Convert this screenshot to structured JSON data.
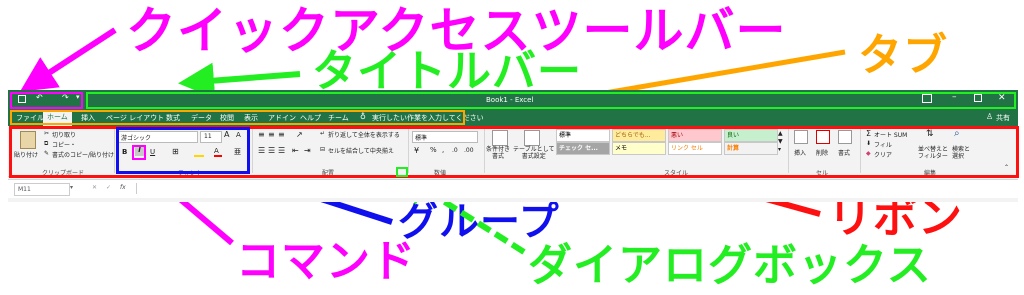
{
  "annotations": {
    "quick_access": "クイックアクセスツールバー",
    "title_bar": "タイトルバー",
    "tab": "タブ",
    "command": "コマンド",
    "group": "グループ",
    "ribbon": "リボン",
    "dialog_box": "ダイアログボックス"
  },
  "colors": {
    "magenta": "#ff00ff",
    "green": "#22ee22",
    "orange": "#ffa500",
    "blue": "#1010ee",
    "red": "#ff1010",
    "excel_green": "#217346"
  },
  "window": {
    "title": "Book1 - Excel",
    "share": "共有"
  },
  "tabs": [
    "ファイル",
    "ホーム",
    "挿入",
    "ページ レイアウト",
    "数式",
    "データ",
    "校閲",
    "表示",
    "アドイン",
    "ヘルプ",
    "チーム"
  ],
  "tell_me": "実行したい作業を入力してください",
  "clipboard": {
    "paste": "貼り付け",
    "cut": "切り取り",
    "copy": "コピー・",
    "format_painter": "書式のコピー/貼り付け",
    "label": "クリップボード"
  },
  "font": {
    "name": "游ゴシック",
    "size": "11",
    "grow": "A",
    "shrink": "A",
    "bold": "B",
    "italic": "I",
    "underline": "U",
    "label": "フォント"
  },
  "alignment": {
    "wrap": "折り返して全体を表示する",
    "merge": "セルを結合して中央揃え",
    "label": "配置"
  },
  "number": {
    "format": "標準",
    "percent": "%",
    "comma": ",",
    "label": "数値"
  },
  "styles": {
    "conditional": "条件付き\n書式",
    "table": "テーブルとして\n書式設定",
    "cells": [
      "標準",
      "どちらでも...",
      "悪い",
      "良い",
      "チェック セ...",
      "メモ",
      "リンク セル",
      "計算"
    ],
    "label": "スタイル"
  },
  "cells_group": {
    "insert": "挿入",
    "delete": "削除",
    "format": "書式",
    "label": "セル"
  },
  "editing": {
    "autosum": "オート SUM",
    "fill": "フィル",
    "clear": "クリア",
    "sort": "並べ替えと\nフィルター",
    "find": "検索と\n選択",
    "label": "編集"
  },
  "formula_bar": {
    "name_box": "M11",
    "fx": "fx"
  }
}
